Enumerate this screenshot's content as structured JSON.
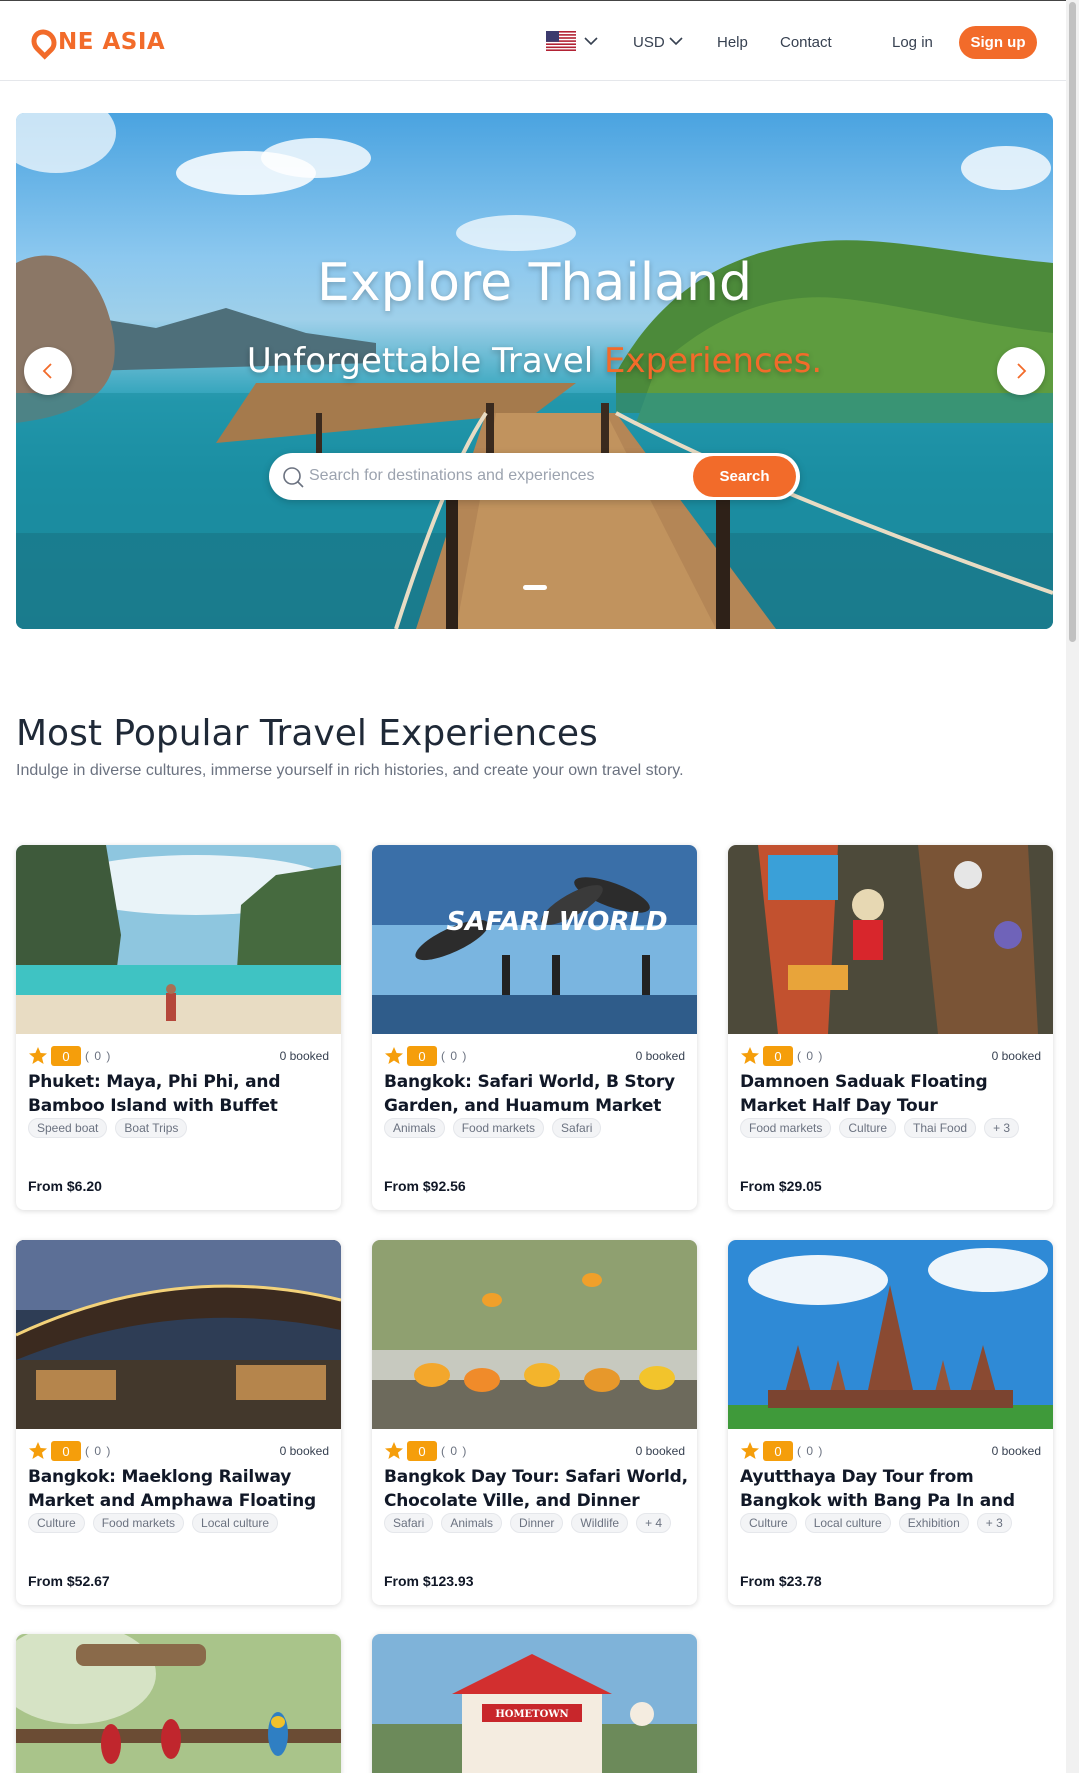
{
  "brand": {
    "name": "NE ASIA",
    "accent": "#f26b2a"
  },
  "header": {
    "currency": "USD",
    "help": "Help",
    "contact": "Contact",
    "login": "Log in",
    "signup": "Sign up",
    "language_flag": "us-flag-icon"
  },
  "hero": {
    "title": "Explore Thailand",
    "subtitle_main": "Unforgettable Travel ",
    "subtitle_accent": "Experiences.",
    "search_placeholder": "Search for destinations and experiences",
    "search_button": "Search"
  },
  "section": {
    "title": "Most Popular Travel Experiences",
    "subtitle": "Indulge in diverse cultures, immerse yourself in rich histories, and create your own travel story."
  },
  "cards": [
    {
      "score": "0",
      "reviews": "( 0 )",
      "booked": "0 booked",
      "title": "Phuket: Maya, Phi Phi, and Bamboo Island with Buffet Lunch",
      "tags": [
        "Speed boat",
        "Boat Trips"
      ],
      "price": "From $6.20"
    },
    {
      "score": "0",
      "reviews": "( 0 )",
      "booked": "0 booked",
      "title": "Bangkok: Safari World, B Story Garden, and Huamum Market",
      "tags": [
        "Animals",
        "Food markets",
        "Safari"
      ],
      "price": "From $92.56"
    },
    {
      "score": "0",
      "reviews": "( 0 )",
      "booked": "0 booked",
      "title": "Damnoen Saduak Floating Market Half Day Tour",
      "tags": [
        "Food markets",
        "Culture",
        "Thai Food",
        "+ 3"
      ],
      "price": "From $29.05"
    },
    {
      "score": "0",
      "reviews": "( 0 )",
      "booked": "0 booked",
      "title": "Bangkok: Maeklong Railway Market and Amphawa Floating Market",
      "tags": [
        "Culture",
        "Food markets",
        "Local culture"
      ],
      "price": "From $52.67"
    },
    {
      "score": "0",
      "reviews": "( 0 )",
      "booked": "0 booked",
      "title": "Bangkok Day Tour: Safari World, Chocolate Ville, and Dinner Cruise...",
      "tags": [
        "Safari",
        "Animals",
        "Dinner",
        "Wildlife",
        "+ 4"
      ],
      "price": "From $123.93"
    },
    {
      "score": "0",
      "reviews": "( 0 )",
      "booked": "0 booked",
      "title": "Ayutthaya Day Tour from Bangkok with Bang Pa In and Night Market",
      "tags": [
        "Culture",
        "Local culture",
        "Exhibition",
        "+ 3"
      ],
      "price": "From $23.78"
    }
  ],
  "card_image_text": {
    "safari_sign": "SAFARI WORLD",
    "hometown_sign": "HOMETOWN"
  }
}
